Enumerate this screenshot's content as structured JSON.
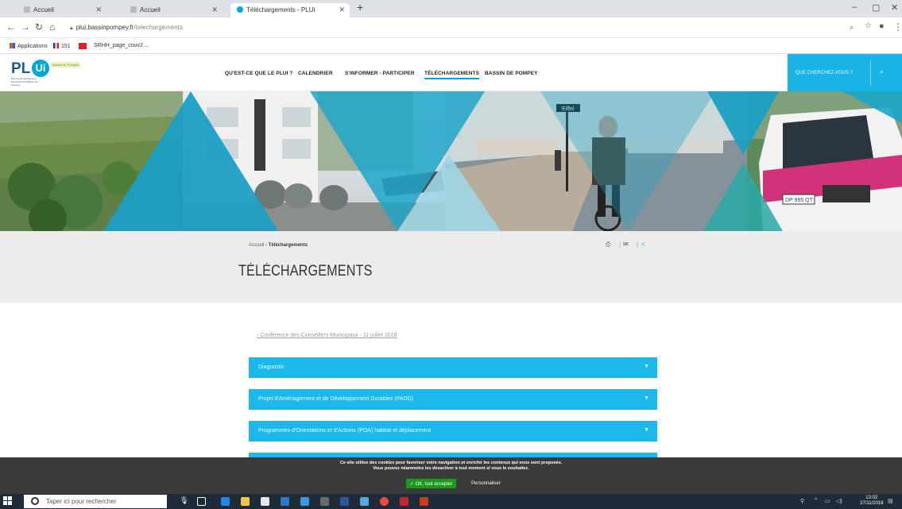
{
  "browser": {
    "tabs": [
      {
        "label": "Accueil"
      },
      {
        "label": "Accueil"
      },
      {
        "label": "Téléchargements - PLUi"
      }
    ],
    "new_tab": "+",
    "url_host": "plui.bassinpompey.fr",
    "url_path": "/telechargements",
    "bookmarks": [
      {
        "label": "Applications"
      },
      {
        "label": "151"
      },
      {
        "label": "SRHH_page_couv2...."
      }
    ]
  },
  "site": {
    "logo": {
      "text_pl": "PL",
      "text_ui": "Ui",
      "subtitle": "Plan Local d'Urbanisme intercommunal Bassin de Pompey",
      "badge": "Bassin de Pompey"
    },
    "menu": [
      {
        "label": "QU'EST-CE QUE LE PLUI ?",
        "active": false
      },
      {
        "label": "CALENDRIER",
        "active": false
      },
      {
        "label": "S'INFORMER - PARTICIPER",
        "active": false
      },
      {
        "label": "TÉLÉCHARGEMENTS",
        "active": true
      },
      {
        "label": "BASSIN DE POMPEY",
        "active": false
      }
    ],
    "search_label": "QUE CHERCHEZ-VOUS ?"
  },
  "hero": {
    "sign_text": "Eiffel",
    "plate_text": "DP 995 QT"
  },
  "page": {
    "breadcrumb_home": "Accueil",
    "breadcrumb_sep": " › ",
    "breadcrumb_current": "Téléchargements",
    "title": "TÉLÉCHARGEMENTS",
    "conference_link": "› Conférence des Conseillers Municipaux - 11 juillet 2018",
    "accordions": [
      {
        "label": "Diagnostic"
      },
      {
        "label": "Projet d'Aménagement et de Développement Durables (PADD)"
      },
      {
        "label": "Programmes d'Orientations et d'Actions (POA) habitat et déplacement"
      },
      {
        "label": ""
      }
    ]
  },
  "cookie": {
    "line1": "Ce site utilise des cookies pour favoriser votre navigation et enrichir les contenus qui vous sont proposés.",
    "line2": "Vous pouvez néanmoins les désactiver à tout moment si vous le souhaitez.",
    "accept": "✓ OK, tout accepter",
    "customize": "Personnaliser"
  },
  "taskbar": {
    "search_placeholder": "Taper ici pour rechercher",
    "time": "13:02",
    "date": "27/11/2018"
  }
}
